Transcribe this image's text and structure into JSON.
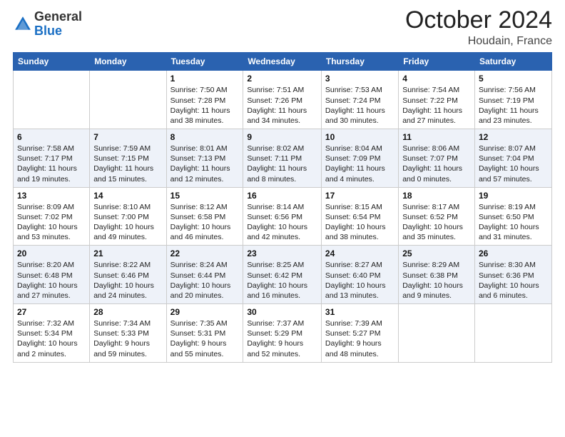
{
  "header": {
    "logo_general": "General",
    "logo_blue": "Blue",
    "month": "October 2024",
    "location": "Houdain, France"
  },
  "weekdays": [
    "Sunday",
    "Monday",
    "Tuesday",
    "Wednesday",
    "Thursday",
    "Friday",
    "Saturday"
  ],
  "weeks": [
    [
      {
        "day": "",
        "info": ""
      },
      {
        "day": "",
        "info": ""
      },
      {
        "day": "1",
        "info": "Sunrise: 7:50 AM\nSunset: 7:28 PM\nDaylight: 11 hours and 38 minutes."
      },
      {
        "day": "2",
        "info": "Sunrise: 7:51 AM\nSunset: 7:26 PM\nDaylight: 11 hours and 34 minutes."
      },
      {
        "day": "3",
        "info": "Sunrise: 7:53 AM\nSunset: 7:24 PM\nDaylight: 11 hours and 30 minutes."
      },
      {
        "day": "4",
        "info": "Sunrise: 7:54 AM\nSunset: 7:22 PM\nDaylight: 11 hours and 27 minutes."
      },
      {
        "day": "5",
        "info": "Sunrise: 7:56 AM\nSunset: 7:19 PM\nDaylight: 11 hours and 23 minutes."
      }
    ],
    [
      {
        "day": "6",
        "info": "Sunrise: 7:58 AM\nSunset: 7:17 PM\nDaylight: 11 hours and 19 minutes."
      },
      {
        "day": "7",
        "info": "Sunrise: 7:59 AM\nSunset: 7:15 PM\nDaylight: 11 hours and 15 minutes."
      },
      {
        "day": "8",
        "info": "Sunrise: 8:01 AM\nSunset: 7:13 PM\nDaylight: 11 hours and 12 minutes."
      },
      {
        "day": "9",
        "info": "Sunrise: 8:02 AM\nSunset: 7:11 PM\nDaylight: 11 hours and 8 minutes."
      },
      {
        "day": "10",
        "info": "Sunrise: 8:04 AM\nSunset: 7:09 PM\nDaylight: 11 hours and 4 minutes."
      },
      {
        "day": "11",
        "info": "Sunrise: 8:06 AM\nSunset: 7:07 PM\nDaylight: 11 hours and 0 minutes."
      },
      {
        "day": "12",
        "info": "Sunrise: 8:07 AM\nSunset: 7:04 PM\nDaylight: 10 hours and 57 minutes."
      }
    ],
    [
      {
        "day": "13",
        "info": "Sunrise: 8:09 AM\nSunset: 7:02 PM\nDaylight: 10 hours and 53 minutes."
      },
      {
        "day": "14",
        "info": "Sunrise: 8:10 AM\nSunset: 7:00 PM\nDaylight: 10 hours and 49 minutes."
      },
      {
        "day": "15",
        "info": "Sunrise: 8:12 AM\nSunset: 6:58 PM\nDaylight: 10 hours and 46 minutes."
      },
      {
        "day": "16",
        "info": "Sunrise: 8:14 AM\nSunset: 6:56 PM\nDaylight: 10 hours and 42 minutes."
      },
      {
        "day": "17",
        "info": "Sunrise: 8:15 AM\nSunset: 6:54 PM\nDaylight: 10 hours and 38 minutes."
      },
      {
        "day": "18",
        "info": "Sunrise: 8:17 AM\nSunset: 6:52 PM\nDaylight: 10 hours and 35 minutes."
      },
      {
        "day": "19",
        "info": "Sunrise: 8:19 AM\nSunset: 6:50 PM\nDaylight: 10 hours and 31 minutes."
      }
    ],
    [
      {
        "day": "20",
        "info": "Sunrise: 8:20 AM\nSunset: 6:48 PM\nDaylight: 10 hours and 27 minutes."
      },
      {
        "day": "21",
        "info": "Sunrise: 8:22 AM\nSunset: 6:46 PM\nDaylight: 10 hours and 24 minutes."
      },
      {
        "day": "22",
        "info": "Sunrise: 8:24 AM\nSunset: 6:44 PM\nDaylight: 10 hours and 20 minutes."
      },
      {
        "day": "23",
        "info": "Sunrise: 8:25 AM\nSunset: 6:42 PM\nDaylight: 10 hours and 16 minutes."
      },
      {
        "day": "24",
        "info": "Sunrise: 8:27 AM\nSunset: 6:40 PM\nDaylight: 10 hours and 13 minutes."
      },
      {
        "day": "25",
        "info": "Sunrise: 8:29 AM\nSunset: 6:38 PM\nDaylight: 10 hours and 9 minutes."
      },
      {
        "day": "26",
        "info": "Sunrise: 8:30 AM\nSunset: 6:36 PM\nDaylight: 10 hours and 6 minutes."
      }
    ],
    [
      {
        "day": "27",
        "info": "Sunrise: 7:32 AM\nSunset: 5:34 PM\nDaylight: 10 hours and 2 minutes."
      },
      {
        "day": "28",
        "info": "Sunrise: 7:34 AM\nSunset: 5:33 PM\nDaylight: 9 hours and 59 minutes."
      },
      {
        "day": "29",
        "info": "Sunrise: 7:35 AM\nSunset: 5:31 PM\nDaylight: 9 hours and 55 minutes."
      },
      {
        "day": "30",
        "info": "Sunrise: 7:37 AM\nSunset: 5:29 PM\nDaylight: 9 hours and 52 minutes."
      },
      {
        "day": "31",
        "info": "Sunrise: 7:39 AM\nSunset: 5:27 PM\nDaylight: 9 hours and 48 minutes."
      },
      {
        "day": "",
        "info": ""
      },
      {
        "day": "",
        "info": ""
      }
    ]
  ]
}
